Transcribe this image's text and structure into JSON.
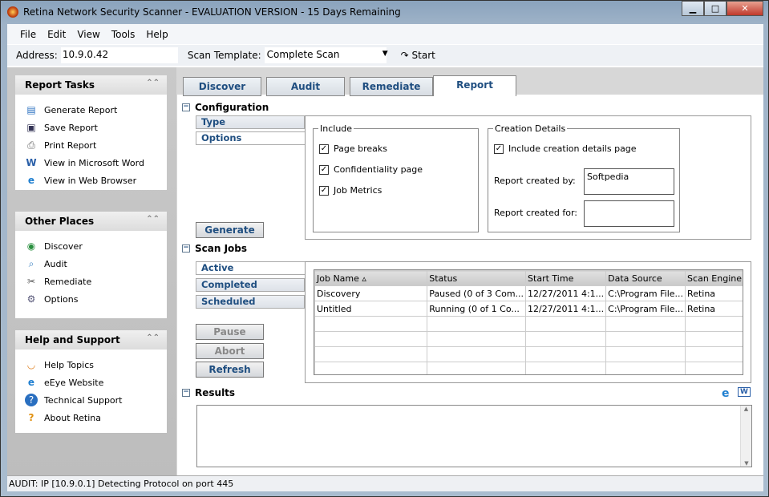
{
  "window": {
    "title": "Retina Network Security Scanner - EVALUATION VERSION - 15  Days Remaining",
    "minimize": "▁",
    "maximize": "□",
    "close": "✕"
  },
  "menu": [
    "File",
    "Edit",
    "View",
    "Tools",
    "Help"
  ],
  "toolbar": {
    "address_label": "Address:",
    "address_value": "10.9.0.42",
    "template_label": "Scan Template:",
    "template_value": "Complete Scan",
    "start_label": "Start"
  },
  "sidebar": {
    "report_tasks": {
      "title": "Report Tasks",
      "items": [
        "Generate Report",
        "Save Report",
        "Print Report",
        "View in Microsoft Word",
        "View in Web Browser"
      ]
    },
    "other_places": {
      "title": "Other Places",
      "items": [
        "Discover",
        "Audit",
        "Remediate",
        "Options"
      ]
    },
    "help": {
      "title": "Help and Support",
      "items": [
        "Help Topics",
        "eEye Website",
        "Technical Support",
        "About Retina"
      ]
    }
  },
  "tabs": [
    "Discover",
    "Audit",
    "Remediate",
    "Report"
  ],
  "configuration": {
    "title": "Configuration",
    "subtabs": [
      "Type",
      "Options"
    ],
    "include": {
      "title": "Include",
      "options": [
        {
          "label": "Page breaks",
          "checked": true
        },
        {
          "label": "Confidentiality page",
          "checked": true
        },
        {
          "label": "Job Metrics",
          "checked": true
        }
      ]
    },
    "creation": {
      "title": "Creation Details",
      "include_label": "Include creation details page",
      "include_checked": true,
      "created_by_label": "Report created by:",
      "created_by_value": "Softpedia",
      "created_for_label": "Report created for:",
      "created_for_value": ""
    },
    "generate": "Generate"
  },
  "scan_jobs": {
    "title": "Scan Jobs",
    "subtabs": [
      "Active",
      "Completed",
      "Scheduled"
    ],
    "buttons": [
      "Pause",
      "Abort",
      "Refresh"
    ],
    "columns": [
      "Job Name ▵",
      "Status",
      "Start Time",
      "Data Source",
      "Scan Engine"
    ],
    "rows": [
      [
        "Discovery",
        "Paused (0 of 3 Com...",
        "12/27/2011 4:1...",
        "C:\\Program File...",
        "Retina"
      ],
      [
        "Untitled",
        "Running (0 of 1 Co...",
        "12/27/2011 4:1...",
        "C:\\Program File...",
        "Retina"
      ]
    ]
  },
  "results": {
    "title": "Results"
  },
  "status_bar": "AUDIT: IP [10.9.0.1] Detecting Protocol on port 445"
}
